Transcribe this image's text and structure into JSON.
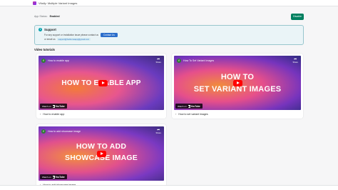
{
  "app": {
    "title": "Vitally: Multiple Variant Images"
  },
  "status": {
    "label": "App Status:",
    "value": "Enabled",
    "button": "Disable"
  },
  "support": {
    "title": "Support",
    "text": "For any support or installation issue please contact us",
    "contact_button": "Contact Us",
    "email_label": "or email us",
    "email": "support@harborusapp@gmail.com"
  },
  "videos": {
    "section_title": "Video tutorials",
    "items": [
      {
        "yt_title": "How to enable app",
        "overlay": "HOW TO ENABLE APP",
        "caption": "How to enable app"
      },
      {
        "yt_title": "How To Set Variant Images",
        "overlay_line1": "HOW TO",
        "overlay_line2": "SET VARIANT IMAGES",
        "caption": "How to set variant images"
      },
      {
        "yt_title": "How to add showcase image",
        "overlay_line1": "HOW TO ADD",
        "overlay_line2": "SHOWCASE IMAGE",
        "caption": "How to add showcase image"
      }
    ],
    "watch_on": "Watch on",
    "youtube": "YouTube",
    "share": "Share",
    "channel_initial": "f"
  }
}
